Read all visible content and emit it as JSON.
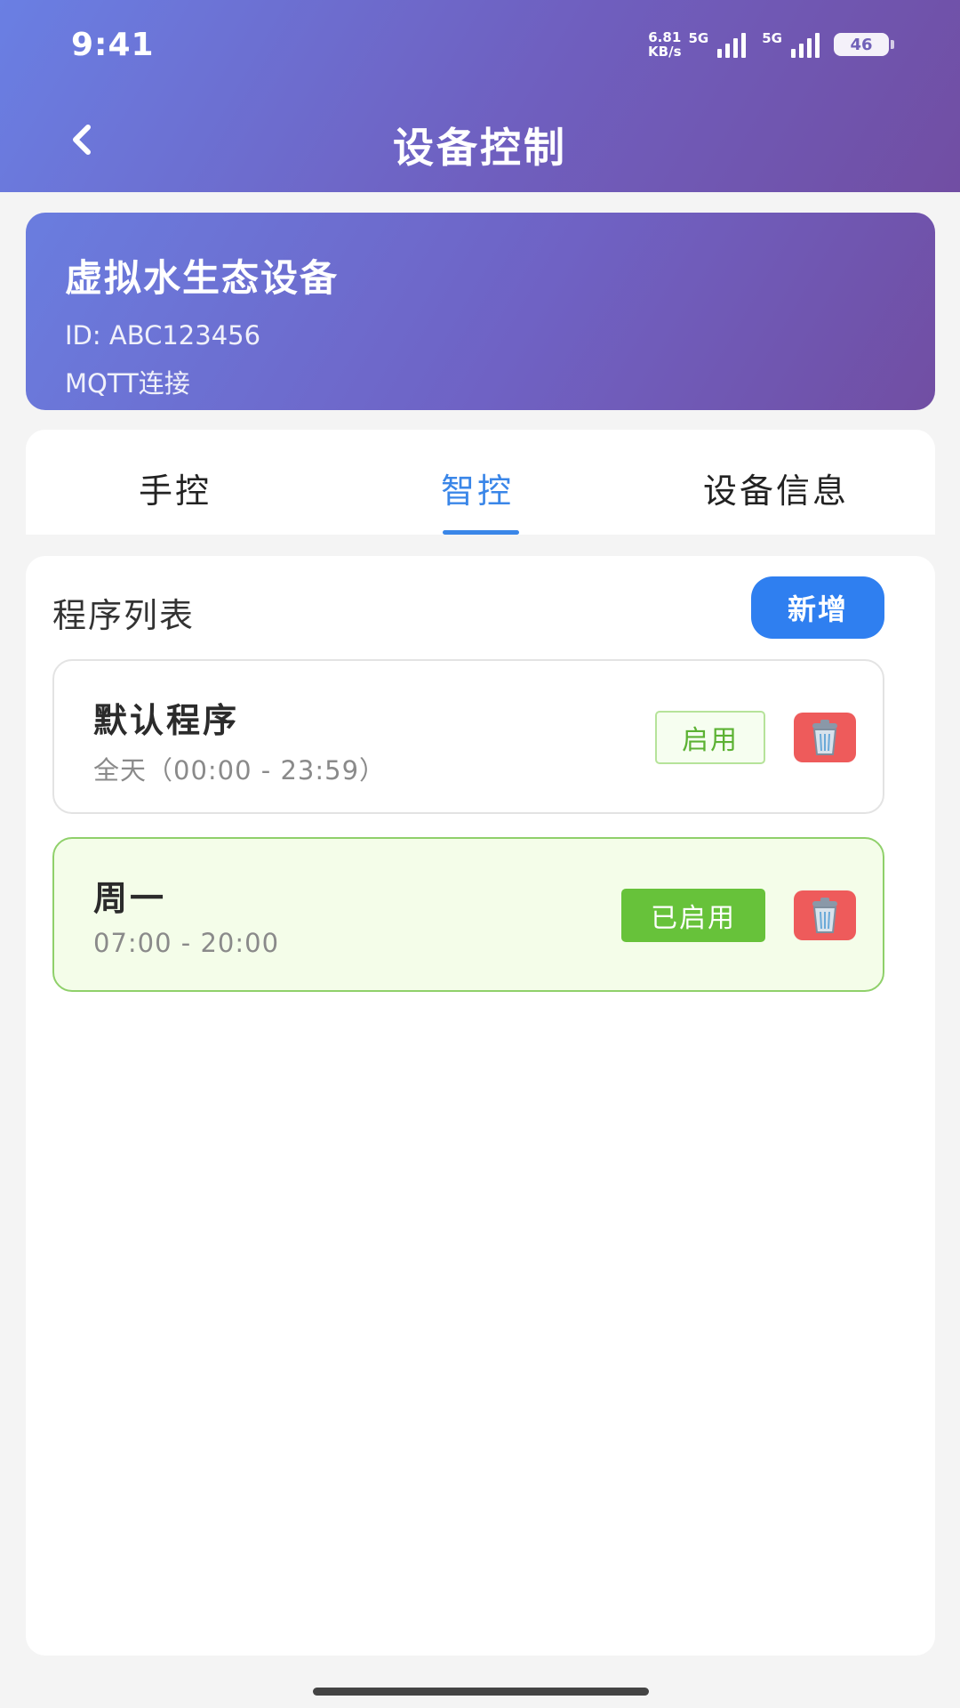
{
  "status_bar": {
    "time": "9:41",
    "net_speed_value": "6.81",
    "net_speed_unit": "KB/s",
    "signal1_label": "5G",
    "signal2_label": "5G",
    "battery": "46"
  },
  "header": {
    "title": "设备控制"
  },
  "device": {
    "name": "虚拟水生态设备",
    "id": "ID: ABC123456",
    "connection": "MQTT连接"
  },
  "tabs": [
    {
      "label": "手控"
    },
    {
      "label": "智控"
    },
    {
      "label": "设备信息"
    }
  ],
  "active_tab": "智控",
  "program_list": {
    "title": "程序列表",
    "add_label": "新增",
    "items": [
      {
        "name": "默认程序",
        "time": "全天（00:00 - 23:59）",
        "status_label": "启用",
        "enabled": false
      },
      {
        "name": "周一",
        "time": "07:00 - 20:00",
        "status_label": "已启用",
        "enabled": true
      }
    ]
  },
  "colors": {
    "header_gradient_start": "#6a7fe3",
    "header_gradient_end": "#714ea3",
    "accent_blue": "#3a86e8",
    "enabled_green": "#67c23a",
    "delete_red": "#ee5b5b"
  },
  "icons": {
    "back": "chevron-left-icon",
    "delete": "trash-icon"
  }
}
